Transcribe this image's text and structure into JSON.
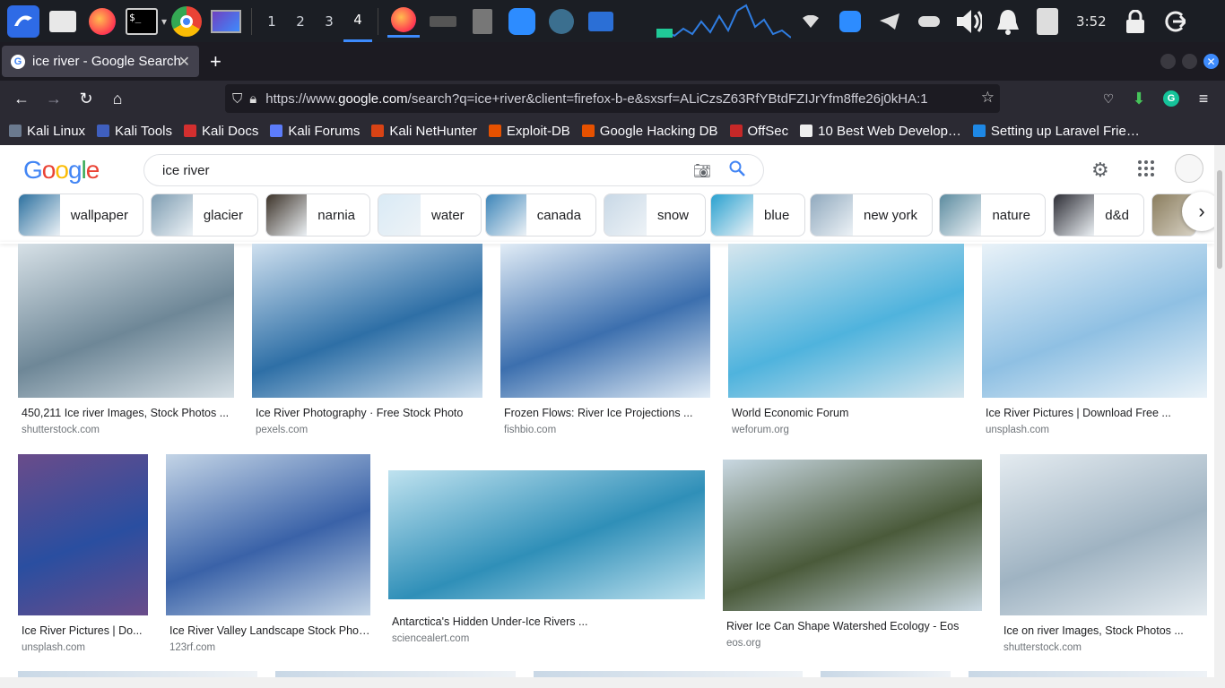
{
  "taskbar": {
    "workspaces": [
      "1",
      "2",
      "3",
      "4"
    ],
    "active_workspace": "4",
    "clock": "3:52"
  },
  "browser": {
    "tab_title": "ice river - Google Search",
    "url_prefix": "https://www.",
    "url_domain": "google.com",
    "url_rest": "/search?q=ice+river&client=firefox-b-e&sxsrf=ALiCzsZ63RfYBtdFZIJrYfm8ffe26j0kHA:1"
  },
  "bookmarks": [
    {
      "label": "Kali Linux",
      "color": "#6b7a8f"
    },
    {
      "label": "Kali Tools",
      "color": "#3f5fbf"
    },
    {
      "label": "Kali Docs",
      "color": "#d32f2f"
    },
    {
      "label": "Kali Forums",
      "color": "#5c7cfa"
    },
    {
      "label": "Kali NetHunter",
      "color": "#d84315"
    },
    {
      "label": "Exploit-DB",
      "color": "#e65100"
    },
    {
      "label": "Google Hacking DB",
      "color": "#e65100"
    },
    {
      "label": "OffSec",
      "color": "#c62828"
    },
    {
      "label": "10 Best Web Develop…",
      "color": "#eeeeee"
    },
    {
      "label": "Setting up Laravel Frie…",
      "color": "#1e88e5"
    }
  ],
  "google": {
    "logo": "Google",
    "query": "ice river",
    "chips": [
      {
        "label": "wallpaper",
        "color": "#2a6f9e"
      },
      {
        "label": "glacier",
        "color": "#7c9bb0"
      },
      {
        "label": "narnia",
        "color": "#3a3026"
      },
      {
        "label": "water",
        "color": "#d9eaf5"
      },
      {
        "label": "canada",
        "color": "#3b84b8"
      },
      {
        "label": "snow",
        "color": "#c8d8e6"
      },
      {
        "label": "blue",
        "color": "#27a0cf"
      },
      {
        "label": "new york",
        "color": "#8fa8bd"
      },
      {
        "label": "nature",
        "color": "#5a8a9e"
      },
      {
        "label": "d&d",
        "color": "#2b2b33"
      }
    ],
    "results_row1": [
      {
        "title": "450,211 Ice river Images, Stock Photos ...",
        "source": "shutterstock.com",
        "color": "#6e8797",
        "color2": "#d6e0e6"
      },
      {
        "title": "Ice River Photography · Free Stock Photo",
        "source": "pexels.com",
        "color": "#2e6fa6",
        "color2": "#cfe0ef"
      },
      {
        "title": "Frozen Flows: River Ice Projections ...",
        "source": "fishbio.com",
        "color": "#3c6fae",
        "color2": "#e1ecf6"
      },
      {
        "title": "World Economic Forum",
        "source": "weforum.org",
        "color": "#4fb3dd",
        "color2": "#d6e6ee"
      },
      {
        "title": "Ice River Pictures | Download Free ...",
        "source": "unsplash.com",
        "color": "#8fc0e3",
        "color2": "#e9f2f8"
      }
    ],
    "results_row2": [
      {
        "title": "Ice River Pictures | Do...",
        "source": "unsplash.com",
        "color": "#2a4ea0",
        "color2": "#6a4c8a"
      },
      {
        "title": "Ice River Valley Landscape Stock Phot...",
        "source": "123rf.com",
        "color": "#3a62a8",
        "color2": "#c3d4e6"
      },
      {
        "title": "Antarctica's Hidden Under-Ice Rivers ...",
        "source": "sciencealert.com",
        "color": "#2f8fb8",
        "color2": "#bfe2ef"
      },
      {
        "title": "River Ice Can Shape Watershed Ecology - Eos",
        "source": "eos.org",
        "color": "#4a5a3a",
        "color2": "#c9d8e2"
      },
      {
        "title": "Ice on river Images, Stock Photos ...",
        "source": "shutterstock.com",
        "color": "#9fb3c2",
        "color2": "#e4ebf0"
      }
    ]
  }
}
